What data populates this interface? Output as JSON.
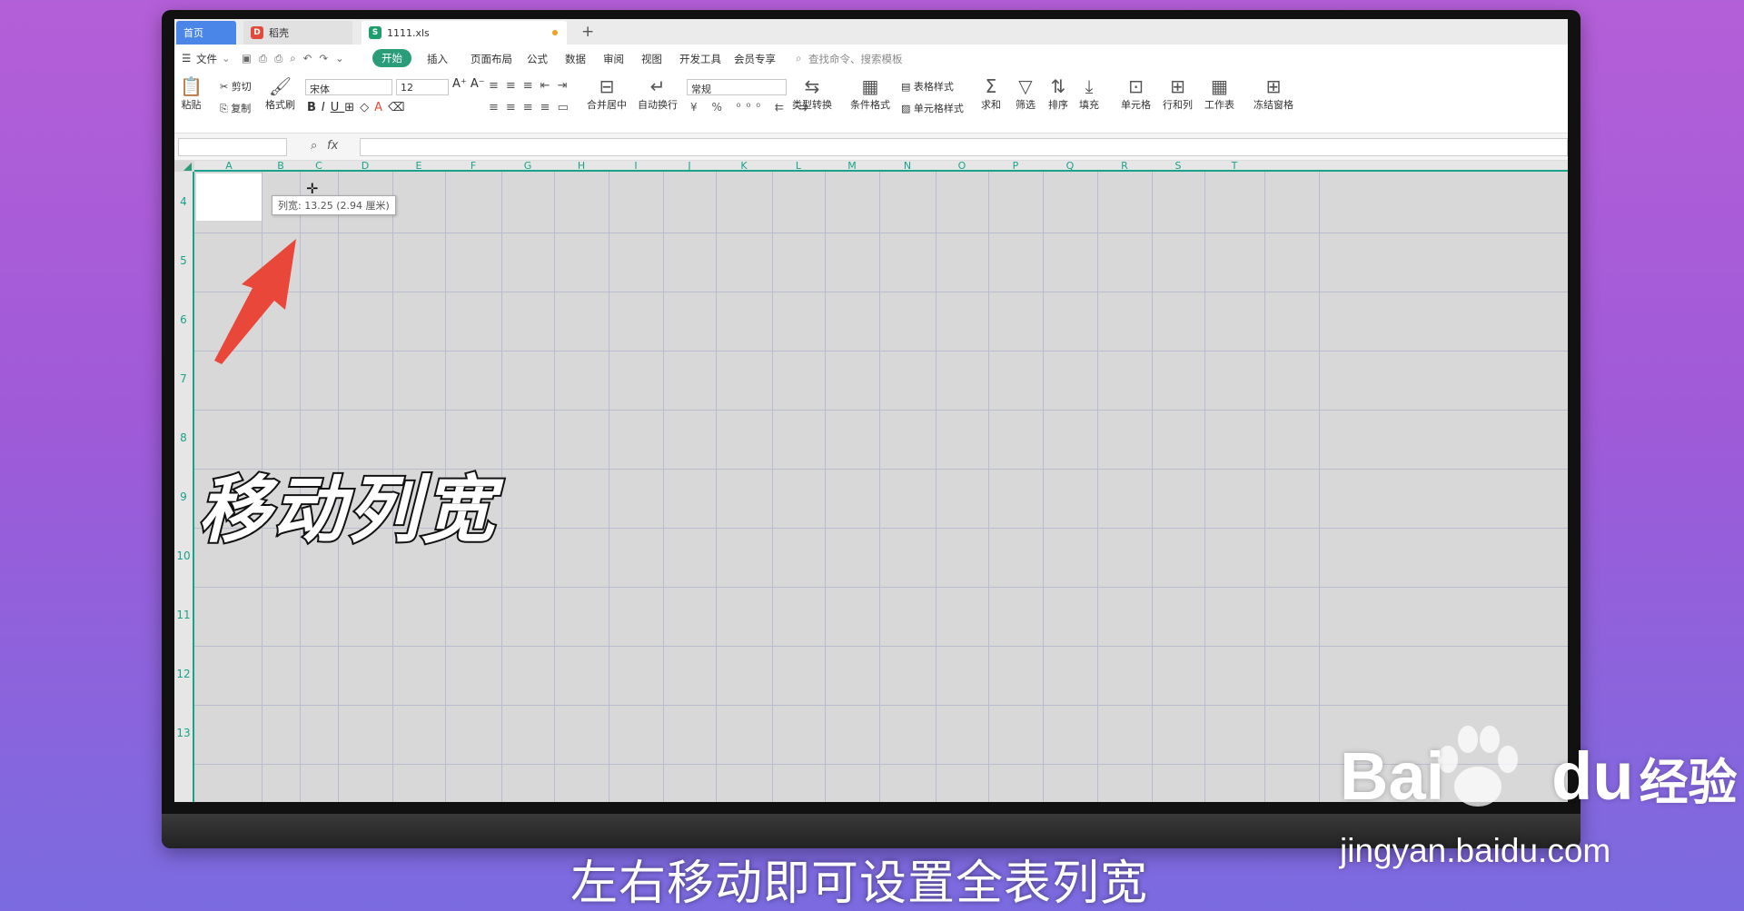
{
  "tabs": {
    "home": "首页",
    "docer": "稻壳",
    "file": "1111.xls"
  },
  "menu": [
    "文件",
    "开始",
    "插入",
    "页面布局",
    "公式",
    "数据",
    "审阅",
    "视图",
    "开发工具",
    "会员专享"
  ],
  "search_placeholder": "查找命令、搜索模板",
  "ribbon": {
    "paste": "粘贴",
    "cut": "剪切",
    "copy": "复制",
    "format_painter": "格式刷",
    "font": "宋体",
    "size": "12",
    "merge": "合并居中",
    "wrap": "自动换行",
    "number_format": "常规",
    "convert": "类型转换",
    "cond_format": "条件格式",
    "table_style": "表格样式",
    "cell_style": "单元格样式",
    "sum": "求和",
    "filter": "筛选",
    "sort": "排序",
    "fill": "填充",
    "cell": "单元格",
    "rowcol": "行和列",
    "sheet": "工作表",
    "freeze": "冻结窗格"
  },
  "columns": [
    "A",
    "B",
    "C",
    "D",
    "E",
    "F",
    "G",
    "H",
    "I",
    "J",
    "K",
    "L",
    "M",
    "N",
    "O",
    "P",
    "Q",
    "R",
    "S",
    "T"
  ],
  "rows": [
    "4",
    "5",
    "6",
    "7",
    "8",
    "9",
    "10",
    "11",
    "12",
    "13"
  ],
  "tooltip": "列宽: 13.25 (2.94 厘米)",
  "overlay_title": "移动列宽",
  "subtitle": "左右移动即可设置全表列宽",
  "watermark": {
    "brand": "Bai",
    "brand_cn": "经验",
    "url": "jingyan.baidu.com"
  },
  "colors": {
    "accent": "#1aa28a",
    "arrow": "#e9473a",
    "home_tab": "#4a86e8"
  }
}
